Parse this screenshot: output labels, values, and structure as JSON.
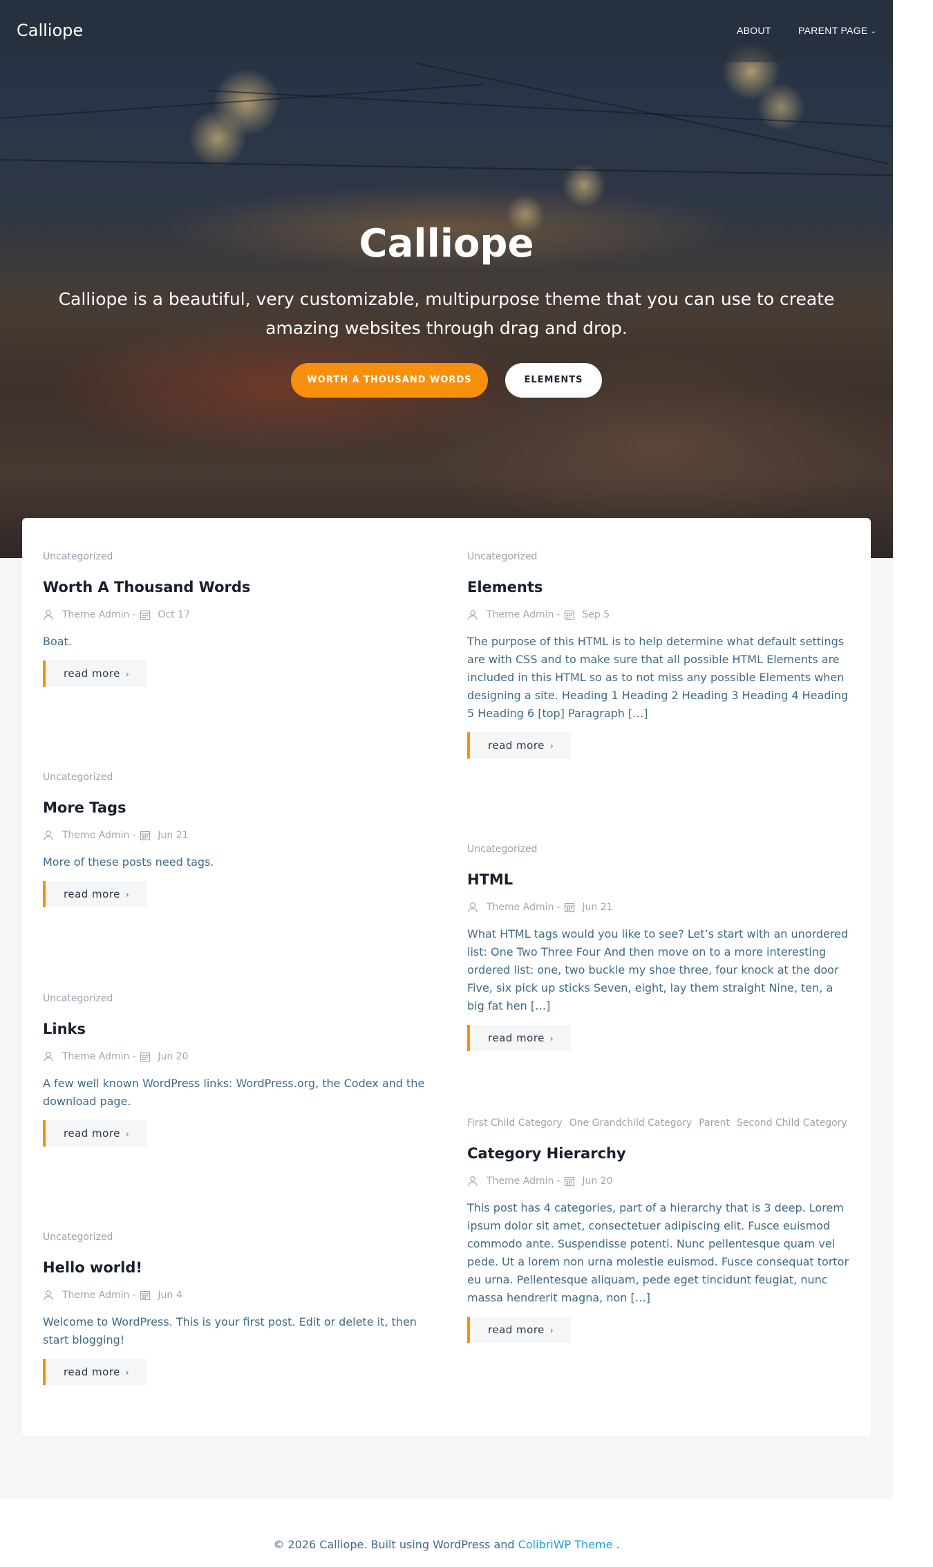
{
  "header": {
    "logo": "Calliope",
    "nav": [
      {
        "label": "ABOUT"
      },
      {
        "label": "PARENT PAGE",
        "has_dropdown": true
      }
    ]
  },
  "hero": {
    "title": "Calliope",
    "subtitle": "Calliope is a beautiful, very customizable, multipurpose theme that you can use to create amazing websites through drag and drop.",
    "primary_button": "WORTH A THOUSAND WORDS",
    "secondary_button": "ELEMENTS"
  },
  "colors": {
    "accent": "#f7900c",
    "title": "#17202b",
    "excerpt": "#3f6a86",
    "link": "#1a9fd8"
  },
  "posts": [
    {
      "categories": [
        "Uncategorized"
      ],
      "title": "Worth A Thousand Words",
      "author": "Theme Admin",
      "date": "Oct 17",
      "excerpt": "Boat.",
      "read_more": "read more"
    },
    {
      "categories": [
        "Uncategorized"
      ],
      "title": "Elements",
      "author": "Theme Admin",
      "date": "Sep 5",
      "excerpt": "The purpose of this HTML is to help determine what default settings are with CSS and to make sure that all possible HTML Elements are included in this HTML so as to not miss any possible Elements when designing a site. Heading 1 Heading 2 Heading 3 Heading 4 Heading 5 Heading 6 [top] Paragraph […]",
      "read_more": "read more"
    },
    {
      "categories": [
        "Uncategorized"
      ],
      "title": "More Tags",
      "author": "Theme Admin",
      "date": "Jun 21",
      "excerpt": "More of these posts need tags.",
      "read_more": "read more"
    },
    {
      "categories": [
        "Uncategorized"
      ],
      "title": "HTML",
      "author": "Theme Admin",
      "date": "Jun 21",
      "excerpt": "What HTML tags would you like to see? Let’s start with an unordered list: One Two Three Four And then move on to a more interesting ordered list: one, two buckle my shoe three, four knock at the door Five, six pick up sticks Seven, eight, lay them straight Nine, ten, a big fat hen […]",
      "read_more": "read more"
    },
    {
      "categories": [
        "Uncategorized"
      ],
      "title": "Links",
      "author": "Theme Admin",
      "date": "Jun 20",
      "excerpt": "A few well known WordPress links: WordPress.org, the Codex and the download page.",
      "read_more": "read more"
    },
    {
      "categories": [
        "First Child Category",
        "One Grandchild Category",
        "Parent",
        "Second Child Category"
      ],
      "title": "Category Hierarchy",
      "author": "Theme Admin",
      "date": "Jun 20",
      "excerpt": "This post has 4 categories, part of a hierarchy that is 3 deep. Lorem ipsum dolor sit amet, consectetuer adipiscing elit. Fusce euismod commodo ante. Suspendisse potenti. Nunc pellentesque quam vel pede. Ut a lorem non urna molestie euismod. Fusce consequat tortor eu urna. Pellentesque aliquam, pede eget tincidunt feugiat, nunc massa hendrerit magna, non […]",
      "read_more": "read more"
    },
    {
      "categories": [
        "Uncategorized"
      ],
      "title": "Hello world!",
      "author": "Theme Admin",
      "date": "Jun 4",
      "excerpt": "Welcome to WordPress. This is your first post. Edit or delete it, then start blogging!",
      "read_more": "read more"
    }
  ],
  "footer": {
    "text": "© 2026 Calliope. Built using WordPress and",
    "link_text": "ColibriWP Theme",
    "suffix": "."
  }
}
